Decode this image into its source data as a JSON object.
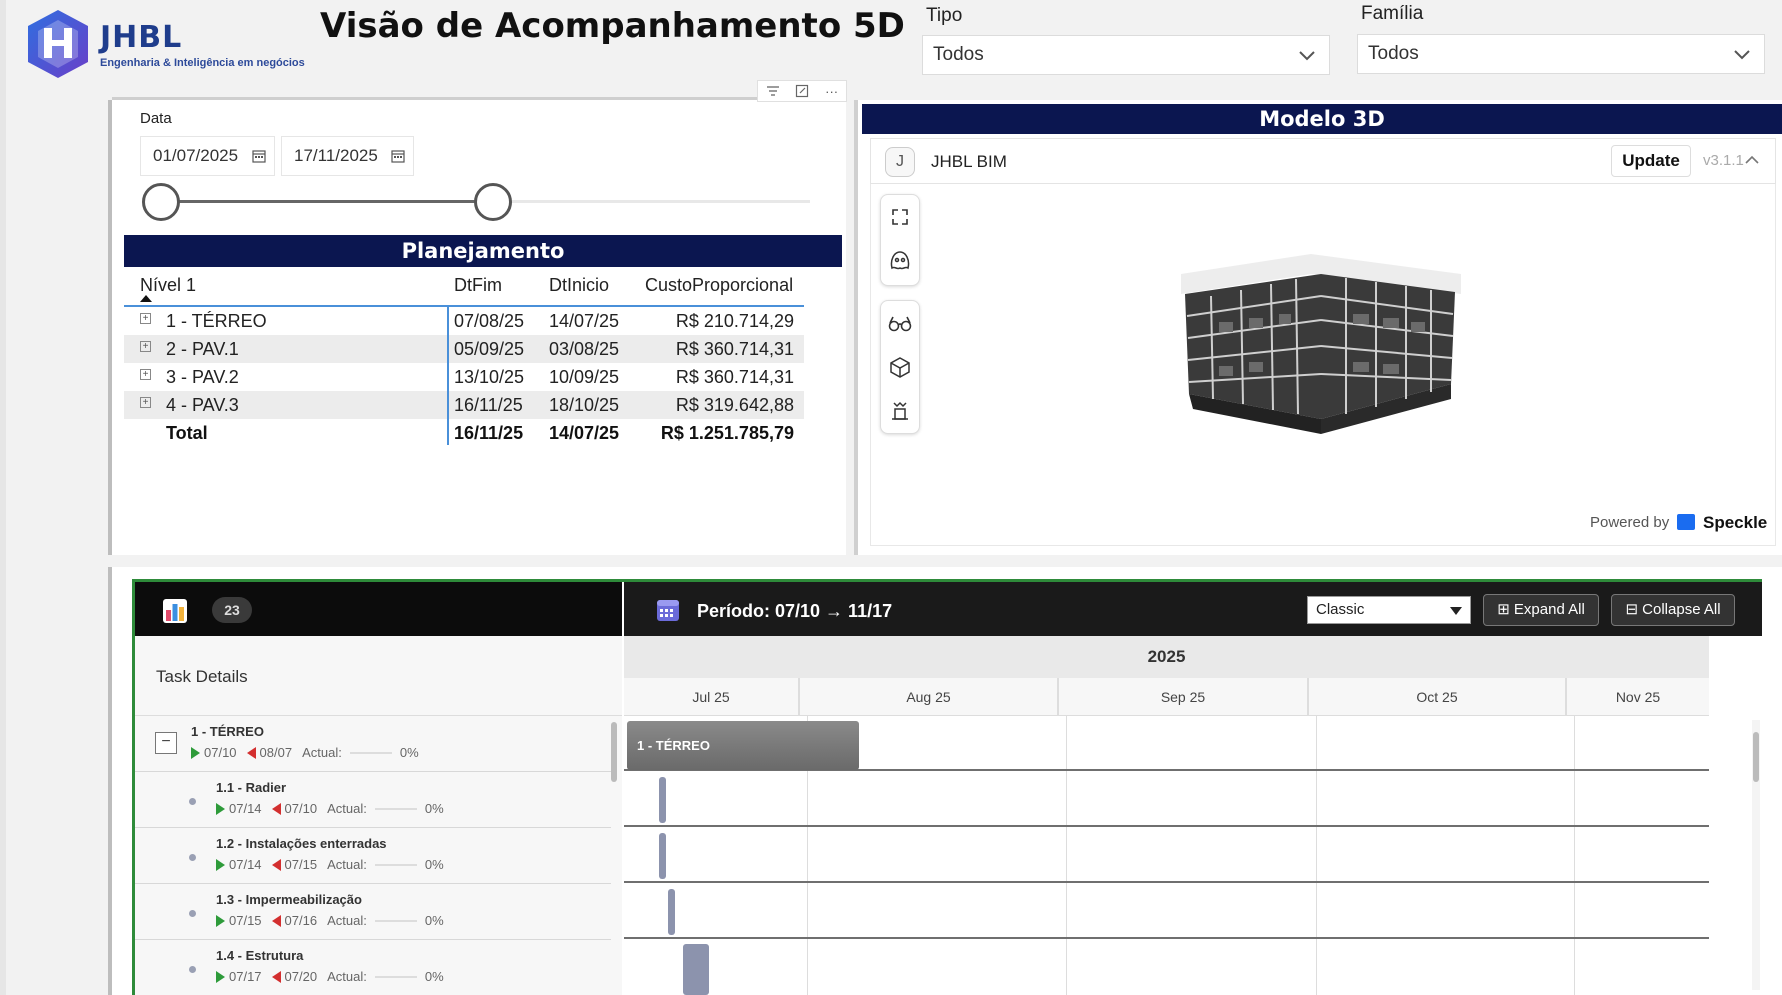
{
  "header": {
    "logo_name": "JHBL",
    "logo_tagline": "Engenharia & Inteligência em negócios",
    "title": "Visão de Acompanhamento 5D"
  },
  "filters": {
    "tipo": {
      "label": "Tipo",
      "value": "Todos"
    },
    "familia": {
      "label": "Família",
      "value": "Todos"
    }
  },
  "date_filter": {
    "label": "Data",
    "start": "01/07/2025",
    "end": "17/11/2025"
  },
  "planejamento": {
    "title": "Planejamento",
    "columns": [
      "Nível 1",
      "DtFim",
      "DtInicio",
      "CustoProporcional"
    ],
    "rows": [
      {
        "nivel": "1 - TÉRREO",
        "dtfim": "07/08/25",
        "dtinicio": "14/07/25",
        "custo": "R$ 210.714,29"
      },
      {
        "nivel": "2 - PAV.1",
        "dtfim": "05/09/25",
        "dtinicio": "03/08/25",
        "custo": "R$ 360.714,31"
      },
      {
        "nivel": "3 - PAV.2",
        "dtfim": "13/10/25",
        "dtinicio": "10/09/25",
        "custo": "R$ 360.714,31"
      },
      {
        "nivel": "4 - PAV.3",
        "dtfim": "16/11/25",
        "dtinicio": "18/10/25",
        "custo": "R$ 319.642,88"
      }
    ],
    "total": {
      "label": "Total",
      "dtfim": "16/11/25",
      "dtinicio": "14/07/25",
      "custo": "R$ 1.251.785,79"
    }
  },
  "modelo3d": {
    "title": "Modelo 3D",
    "avatar_letter": "J",
    "project_name": "JHBL BIM",
    "update_label": "Update",
    "version": "v3.1.1",
    "powered_by": "Powered by",
    "brand": "Speckle",
    "tools": [
      "fullscreen-icon",
      "ghost-icon",
      "glasses-icon",
      "cube-icon",
      "section-icon"
    ]
  },
  "gantt": {
    "task_count": "23",
    "period": "Período: 07/10 → 11/17",
    "view_mode": "Classic",
    "expand_all": "⊞ Expand All",
    "collapse_all": "⊟ Collapse All",
    "task_details_label": "Task Details",
    "year": "2025",
    "months": [
      "Jul 25",
      "Aug 25",
      "Sep 25",
      "Oct 25",
      "Nov 25"
    ],
    "group_bar_label": "1 - TÉRREO",
    "tasks": [
      {
        "name": "1 - TÉRREO",
        "start": "07/10",
        "end": "08/07",
        "actual_label": "Actual:",
        "progress": "0%"
      },
      {
        "name": "1.1 - Radier",
        "start": "07/14",
        "end": "07/10",
        "actual_label": "Actual:",
        "progress": "0%"
      },
      {
        "name": "1.2 - Instalações enterradas",
        "start": "07/14",
        "end": "07/15",
        "actual_label": "Actual:",
        "progress": "0%"
      },
      {
        "name": "1.3 - Impermeabilização",
        "start": "07/15",
        "end": "07/16",
        "actual_label": "Actual:",
        "progress": "0%"
      },
      {
        "name": "1.4 - Estrutura",
        "start": "07/17",
        "end": "07/20",
        "actual_label": "Actual:",
        "progress": "0%"
      }
    ]
  },
  "colors": {
    "navy_header": "#0b1650",
    "gantt_border": "#2e8b3a",
    "speckle_blue": "#1a6cf0",
    "start_marker": "#2e9b3a",
    "end_marker": "#d32f2f"
  }
}
